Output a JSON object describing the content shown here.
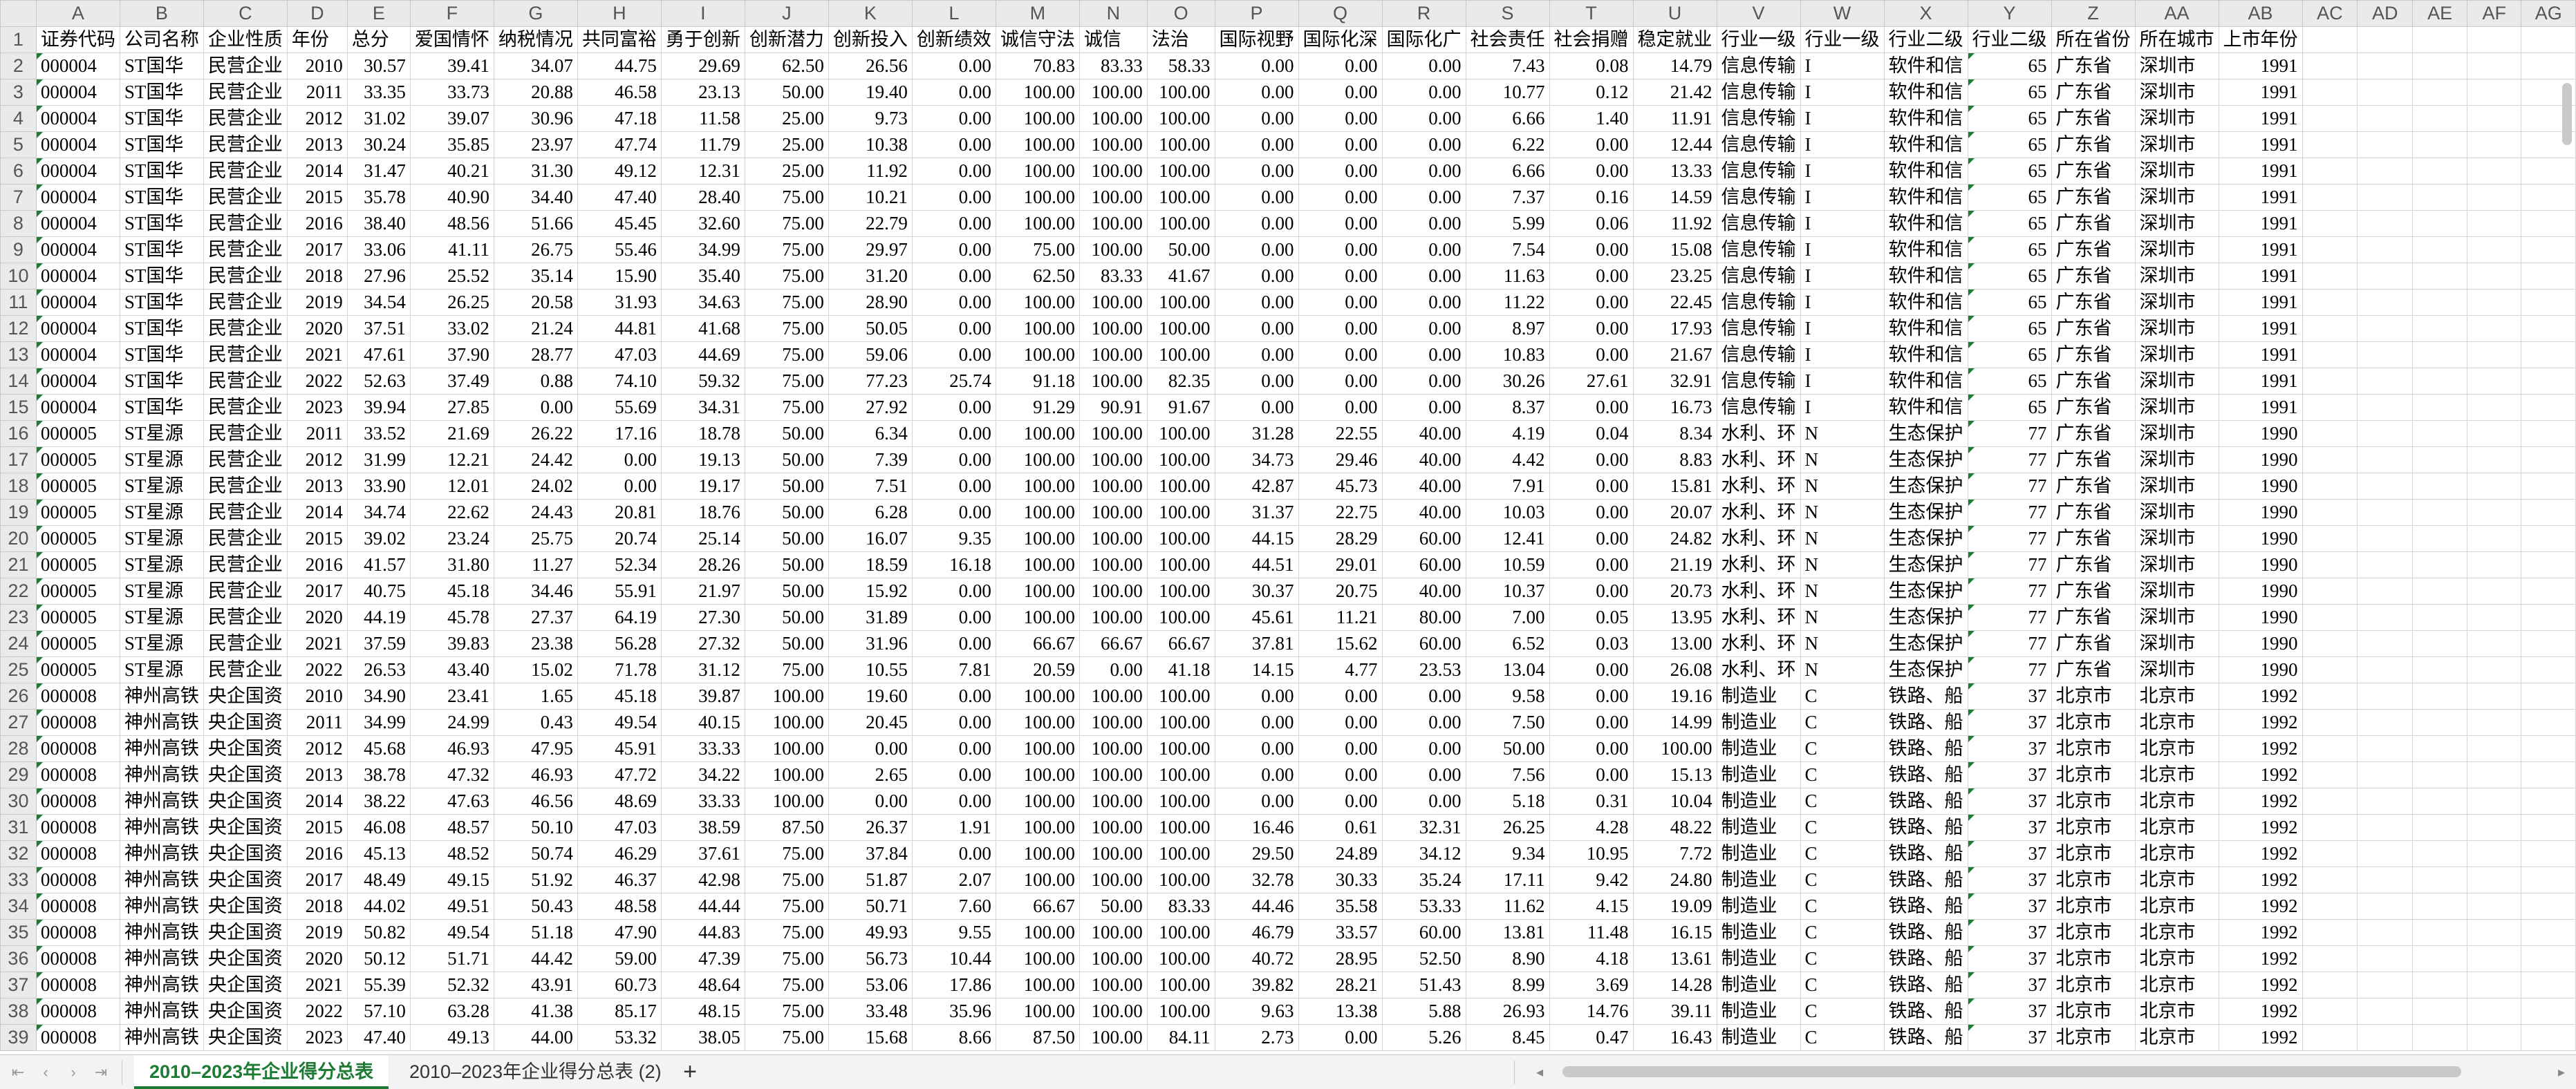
{
  "columns": [
    "A",
    "B",
    "C",
    "D",
    "E",
    "F",
    "G",
    "H",
    "I",
    "J",
    "K",
    "L",
    "M",
    "N",
    "O",
    "P",
    "Q",
    "R",
    "S",
    "T",
    "U",
    "V",
    "W",
    "X",
    "Y",
    "Z",
    "AA",
    "AB",
    "AC",
    "AD",
    "AE",
    "AF",
    "AG"
  ],
  "header_row": [
    "证券代码",
    "公司名称",
    "企业性质",
    "年份",
    "总分",
    "爱国情怀",
    "纳税情况",
    "共同富裕",
    "勇于创新",
    "创新潜力",
    "创新投入",
    "创新绩效",
    "诚信守法",
    "诚信",
    "法治",
    "国际视野",
    "国际化深",
    "国际化广",
    "社会责任",
    "社会捐赠",
    "稳定就业",
    "行业一级",
    "行业一级",
    "行业二级",
    "行业二级",
    "所在省份",
    "所在城市",
    "上市年份",
    "",
    "",
    "",
    "",
    ""
  ],
  "rows": [
    [
      "000004",
      "ST国华",
      "民营企业",
      "2010",
      "30.57",
      "39.41",
      "34.07",
      "44.75",
      "29.69",
      "62.50",
      "26.56",
      "0.00",
      "70.83",
      "83.33",
      "58.33",
      "0.00",
      "0.00",
      "0.00",
      "7.43",
      "0.08",
      "14.79",
      "信息传输",
      "I",
      "软件和信",
      "65",
      "广东省",
      "深圳市",
      "1991"
    ],
    [
      "000004",
      "ST国华",
      "民营企业",
      "2011",
      "33.35",
      "33.73",
      "20.88",
      "46.58",
      "23.13",
      "50.00",
      "19.40",
      "0.00",
      "100.00",
      "100.00",
      "100.00",
      "0.00",
      "0.00",
      "0.00",
      "10.77",
      "0.12",
      "21.42",
      "信息传输",
      "I",
      "软件和信",
      "65",
      "广东省",
      "深圳市",
      "1991"
    ],
    [
      "000004",
      "ST国华",
      "民营企业",
      "2012",
      "31.02",
      "39.07",
      "30.96",
      "47.18",
      "11.58",
      "25.00",
      "9.73",
      "0.00",
      "100.00",
      "100.00",
      "100.00",
      "0.00",
      "0.00",
      "0.00",
      "6.66",
      "1.40",
      "11.91",
      "信息传输",
      "I",
      "软件和信",
      "65",
      "广东省",
      "深圳市",
      "1991"
    ],
    [
      "000004",
      "ST国华",
      "民营企业",
      "2013",
      "30.24",
      "35.85",
      "23.97",
      "47.74",
      "11.79",
      "25.00",
      "10.38",
      "0.00",
      "100.00",
      "100.00",
      "100.00",
      "0.00",
      "0.00",
      "0.00",
      "6.22",
      "0.00",
      "12.44",
      "信息传输",
      "I",
      "软件和信",
      "65",
      "广东省",
      "深圳市",
      "1991"
    ],
    [
      "000004",
      "ST国华",
      "民营企业",
      "2014",
      "31.47",
      "40.21",
      "31.30",
      "49.12",
      "12.31",
      "25.00",
      "11.92",
      "0.00",
      "100.00",
      "100.00",
      "100.00",
      "0.00",
      "0.00",
      "0.00",
      "6.66",
      "0.00",
      "13.33",
      "信息传输",
      "I",
      "软件和信",
      "65",
      "广东省",
      "深圳市",
      "1991"
    ],
    [
      "000004",
      "ST国华",
      "民营企业",
      "2015",
      "35.78",
      "40.90",
      "34.40",
      "47.40",
      "28.40",
      "75.00",
      "10.21",
      "0.00",
      "100.00",
      "100.00",
      "100.00",
      "0.00",
      "0.00",
      "0.00",
      "7.37",
      "0.16",
      "14.59",
      "信息传输",
      "I",
      "软件和信",
      "65",
      "广东省",
      "深圳市",
      "1991"
    ],
    [
      "000004",
      "ST国华",
      "民营企业",
      "2016",
      "38.40",
      "48.56",
      "51.66",
      "45.45",
      "32.60",
      "75.00",
      "22.79",
      "0.00",
      "100.00",
      "100.00",
      "100.00",
      "0.00",
      "0.00",
      "0.00",
      "5.99",
      "0.06",
      "11.92",
      "信息传输",
      "I",
      "软件和信",
      "65",
      "广东省",
      "深圳市",
      "1991"
    ],
    [
      "000004",
      "ST国华",
      "民营企业",
      "2017",
      "33.06",
      "41.11",
      "26.75",
      "55.46",
      "34.99",
      "75.00",
      "29.97",
      "0.00",
      "75.00",
      "100.00",
      "50.00",
      "0.00",
      "0.00",
      "0.00",
      "7.54",
      "0.00",
      "15.08",
      "信息传输",
      "I",
      "软件和信",
      "65",
      "广东省",
      "深圳市",
      "1991"
    ],
    [
      "000004",
      "ST国华",
      "民营企业",
      "2018",
      "27.96",
      "25.52",
      "35.14",
      "15.90",
      "35.40",
      "75.00",
      "31.20",
      "0.00",
      "62.50",
      "83.33",
      "41.67",
      "0.00",
      "0.00",
      "0.00",
      "11.63",
      "0.00",
      "23.25",
      "信息传输",
      "I",
      "软件和信",
      "65",
      "广东省",
      "深圳市",
      "1991"
    ],
    [
      "000004",
      "ST国华",
      "民营企业",
      "2019",
      "34.54",
      "26.25",
      "20.58",
      "31.93",
      "34.63",
      "75.00",
      "28.90",
      "0.00",
      "100.00",
      "100.00",
      "100.00",
      "0.00",
      "0.00",
      "0.00",
      "11.22",
      "0.00",
      "22.45",
      "信息传输",
      "I",
      "软件和信",
      "65",
      "广东省",
      "深圳市",
      "1991"
    ],
    [
      "000004",
      "ST国华",
      "民营企业",
      "2020",
      "37.51",
      "33.02",
      "21.24",
      "44.81",
      "41.68",
      "75.00",
      "50.05",
      "0.00",
      "100.00",
      "100.00",
      "100.00",
      "0.00",
      "0.00",
      "0.00",
      "8.97",
      "0.00",
      "17.93",
      "信息传输",
      "I",
      "软件和信",
      "65",
      "广东省",
      "深圳市",
      "1991"
    ],
    [
      "000004",
      "ST国华",
      "民营企业",
      "2021",
      "47.61",
      "37.90",
      "28.77",
      "47.03",
      "44.69",
      "75.00",
      "59.06",
      "0.00",
      "100.00",
      "100.00",
      "100.00",
      "0.00",
      "0.00",
      "0.00",
      "10.83",
      "0.00",
      "21.67",
      "信息传输",
      "I",
      "软件和信",
      "65",
      "广东省",
      "深圳市",
      "1991"
    ],
    [
      "000004",
      "ST国华",
      "民营企业",
      "2022",
      "52.63",
      "37.49",
      "0.88",
      "74.10",
      "59.32",
      "75.00",
      "77.23",
      "25.74",
      "91.18",
      "100.00",
      "82.35",
      "0.00",
      "0.00",
      "0.00",
      "30.26",
      "27.61",
      "32.91",
      "信息传输",
      "I",
      "软件和信",
      "65",
      "广东省",
      "深圳市",
      "1991"
    ],
    [
      "000004",
      "ST国华",
      "民营企业",
      "2023",
      "39.94",
      "27.85",
      "0.00",
      "55.69",
      "34.31",
      "75.00",
      "27.92",
      "0.00",
      "91.29",
      "90.91",
      "91.67",
      "0.00",
      "0.00",
      "0.00",
      "8.37",
      "0.00",
      "16.73",
      "信息传输",
      "I",
      "软件和信",
      "65",
      "广东省",
      "深圳市",
      "1991"
    ],
    [
      "000005",
      "ST星源",
      "民营企业",
      "2011",
      "33.52",
      "21.69",
      "26.22",
      "17.16",
      "18.78",
      "50.00",
      "6.34",
      "0.00",
      "100.00",
      "100.00",
      "100.00",
      "31.28",
      "22.55",
      "40.00",
      "4.19",
      "0.04",
      "8.34",
      "水利、环",
      "N",
      "生态保护",
      "77",
      "广东省",
      "深圳市",
      "1990"
    ],
    [
      "000005",
      "ST星源",
      "民营企业",
      "2012",
      "31.99",
      "12.21",
      "24.42",
      "0.00",
      "19.13",
      "50.00",
      "7.39",
      "0.00",
      "100.00",
      "100.00",
      "100.00",
      "34.73",
      "29.46",
      "40.00",
      "4.42",
      "0.00",
      "8.83",
      "水利、环",
      "N",
      "生态保护",
      "77",
      "广东省",
      "深圳市",
      "1990"
    ],
    [
      "000005",
      "ST星源",
      "民营企业",
      "2013",
      "33.90",
      "12.01",
      "24.02",
      "0.00",
      "19.17",
      "50.00",
      "7.51",
      "0.00",
      "100.00",
      "100.00",
      "100.00",
      "42.87",
      "45.73",
      "40.00",
      "7.91",
      "0.00",
      "15.81",
      "水利、环",
      "N",
      "生态保护",
      "77",
      "广东省",
      "深圳市",
      "1990"
    ],
    [
      "000005",
      "ST星源",
      "民营企业",
      "2014",
      "34.74",
      "22.62",
      "24.43",
      "20.81",
      "18.76",
      "50.00",
      "6.28",
      "0.00",
      "100.00",
      "100.00",
      "100.00",
      "31.37",
      "22.75",
      "40.00",
      "10.03",
      "0.00",
      "20.07",
      "水利、环",
      "N",
      "生态保护",
      "77",
      "广东省",
      "深圳市",
      "1990"
    ],
    [
      "000005",
      "ST星源",
      "民营企业",
      "2015",
      "39.02",
      "23.24",
      "25.75",
      "20.74",
      "25.14",
      "50.00",
      "16.07",
      "9.35",
      "100.00",
      "100.00",
      "100.00",
      "44.15",
      "28.29",
      "60.00",
      "12.41",
      "0.00",
      "24.82",
      "水利、环",
      "N",
      "生态保护",
      "77",
      "广东省",
      "深圳市",
      "1990"
    ],
    [
      "000005",
      "ST星源",
      "民营企业",
      "2016",
      "41.57",
      "31.80",
      "11.27",
      "52.34",
      "28.26",
      "50.00",
      "18.59",
      "16.18",
      "100.00",
      "100.00",
      "100.00",
      "44.51",
      "29.01",
      "60.00",
      "10.59",
      "0.00",
      "21.19",
      "水利、环",
      "N",
      "生态保护",
      "77",
      "广东省",
      "深圳市",
      "1990"
    ],
    [
      "000005",
      "ST星源",
      "民营企业",
      "2017",
      "40.75",
      "45.18",
      "34.46",
      "55.91",
      "21.97",
      "50.00",
      "15.92",
      "0.00",
      "100.00",
      "100.00",
      "100.00",
      "30.37",
      "20.75",
      "40.00",
      "10.37",
      "0.00",
      "20.73",
      "水利、环",
      "N",
      "生态保护",
      "77",
      "广东省",
      "深圳市",
      "1990"
    ],
    [
      "000005",
      "ST星源",
      "民营企业",
      "2020",
      "44.19",
      "45.78",
      "27.37",
      "64.19",
      "27.30",
      "50.00",
      "31.89",
      "0.00",
      "100.00",
      "100.00",
      "100.00",
      "45.61",
      "11.21",
      "80.00",
      "7.00",
      "0.05",
      "13.95",
      "水利、环",
      "N",
      "生态保护",
      "77",
      "广东省",
      "深圳市",
      "1990"
    ],
    [
      "000005",
      "ST星源",
      "民营企业",
      "2021",
      "37.59",
      "39.83",
      "23.38",
      "56.28",
      "27.32",
      "50.00",
      "31.96",
      "0.00",
      "66.67",
      "66.67",
      "66.67",
      "37.81",
      "15.62",
      "60.00",
      "6.52",
      "0.03",
      "13.00",
      "水利、环",
      "N",
      "生态保护",
      "77",
      "广东省",
      "深圳市",
      "1990"
    ],
    [
      "000005",
      "ST星源",
      "民营企业",
      "2022",
      "26.53",
      "43.40",
      "15.02",
      "71.78",
      "31.12",
      "75.00",
      "10.55",
      "7.81",
      "20.59",
      "0.00",
      "41.18",
      "14.15",
      "4.77",
      "23.53",
      "13.04",
      "0.00",
      "26.08",
      "水利、环",
      "N",
      "生态保护",
      "77",
      "广东省",
      "深圳市",
      "1990"
    ],
    [
      "000008",
      "神州高铁",
      "央企国资",
      "2010",
      "34.90",
      "23.41",
      "1.65",
      "45.18",
      "39.87",
      "100.00",
      "19.60",
      "0.00",
      "100.00",
      "100.00",
      "100.00",
      "0.00",
      "0.00",
      "0.00",
      "9.58",
      "0.00",
      "19.16",
      "制造业",
      "C",
      "铁路、船",
      "37",
      "北京市",
      "北京市",
      "1992"
    ],
    [
      "000008",
      "神州高铁",
      "央企国资",
      "2011",
      "34.99",
      "24.99",
      "0.43",
      "49.54",
      "40.15",
      "100.00",
      "20.45",
      "0.00",
      "100.00",
      "100.00",
      "100.00",
      "0.00",
      "0.00",
      "0.00",
      "7.50",
      "0.00",
      "14.99",
      "制造业",
      "C",
      "铁路、船",
      "37",
      "北京市",
      "北京市",
      "1992"
    ],
    [
      "000008",
      "神州高铁",
      "央企国资",
      "2012",
      "45.68",
      "46.93",
      "47.95",
      "45.91",
      "33.33",
      "100.00",
      "0.00",
      "0.00",
      "100.00",
      "100.00",
      "100.00",
      "0.00",
      "0.00",
      "0.00",
      "50.00",
      "0.00",
      "100.00",
      "制造业",
      "C",
      "铁路、船",
      "37",
      "北京市",
      "北京市",
      "1992"
    ],
    [
      "000008",
      "神州高铁",
      "央企国资",
      "2013",
      "38.78",
      "47.32",
      "46.93",
      "47.72",
      "34.22",
      "100.00",
      "2.65",
      "0.00",
      "100.00",
      "100.00",
      "100.00",
      "0.00",
      "0.00",
      "0.00",
      "7.56",
      "0.00",
      "15.13",
      "制造业",
      "C",
      "铁路、船",
      "37",
      "北京市",
      "北京市",
      "1992"
    ],
    [
      "000008",
      "神州高铁",
      "央企国资",
      "2014",
      "38.22",
      "47.63",
      "46.56",
      "48.69",
      "33.33",
      "100.00",
      "0.00",
      "0.00",
      "100.00",
      "100.00",
      "100.00",
      "0.00",
      "0.00",
      "0.00",
      "5.18",
      "0.31",
      "10.04",
      "制造业",
      "C",
      "铁路、船",
      "37",
      "北京市",
      "北京市",
      "1992"
    ],
    [
      "000008",
      "神州高铁",
      "央企国资",
      "2015",
      "46.08",
      "48.57",
      "50.10",
      "47.03",
      "38.59",
      "87.50",
      "26.37",
      "1.91",
      "100.00",
      "100.00",
      "100.00",
      "16.46",
      "0.61",
      "32.31",
      "26.25",
      "4.28",
      "48.22",
      "制造业",
      "C",
      "铁路、船",
      "37",
      "北京市",
      "北京市",
      "1992"
    ],
    [
      "000008",
      "神州高铁",
      "央企国资",
      "2016",
      "45.13",
      "48.52",
      "50.74",
      "46.29",
      "37.61",
      "75.00",
      "37.84",
      "0.00",
      "100.00",
      "100.00",
      "100.00",
      "29.50",
      "24.89",
      "34.12",
      "9.34",
      "10.95",
      "7.72",
      "制造业",
      "C",
      "铁路、船",
      "37",
      "北京市",
      "北京市",
      "1992"
    ],
    [
      "000008",
      "神州高铁",
      "央企国资",
      "2017",
      "48.49",
      "49.15",
      "51.92",
      "46.37",
      "42.98",
      "75.00",
      "51.87",
      "2.07",
      "100.00",
      "100.00",
      "100.00",
      "32.78",
      "30.33",
      "35.24",
      "17.11",
      "9.42",
      "24.80",
      "制造业",
      "C",
      "铁路、船",
      "37",
      "北京市",
      "北京市",
      "1992"
    ],
    [
      "000008",
      "神州高铁",
      "央企国资",
      "2018",
      "44.02",
      "49.51",
      "50.43",
      "48.58",
      "44.44",
      "75.00",
      "50.71",
      "7.60",
      "66.67",
      "50.00",
      "83.33",
      "44.46",
      "35.58",
      "53.33",
      "11.62",
      "4.15",
      "19.09",
      "制造业",
      "C",
      "铁路、船",
      "37",
      "北京市",
      "北京市",
      "1992"
    ],
    [
      "000008",
      "神州高铁",
      "央企国资",
      "2019",
      "50.82",
      "49.54",
      "51.18",
      "47.90",
      "44.83",
      "75.00",
      "49.93",
      "9.55",
      "100.00",
      "100.00",
      "100.00",
      "46.79",
      "33.57",
      "60.00",
      "13.81",
      "11.48",
      "16.15",
      "制造业",
      "C",
      "铁路、船",
      "37",
      "北京市",
      "北京市",
      "1992"
    ],
    [
      "000008",
      "神州高铁",
      "央企国资",
      "2020",
      "50.12",
      "51.71",
      "44.42",
      "59.00",
      "47.39",
      "75.00",
      "56.73",
      "10.44",
      "100.00",
      "100.00",
      "100.00",
      "40.72",
      "28.95",
      "52.50",
      "8.90",
      "4.18",
      "13.61",
      "制造业",
      "C",
      "铁路、船",
      "37",
      "北京市",
      "北京市",
      "1992"
    ],
    [
      "000008",
      "神州高铁",
      "央企国资",
      "2021",
      "55.39",
      "52.32",
      "43.91",
      "60.73",
      "48.64",
      "75.00",
      "53.06",
      "17.86",
      "100.00",
      "100.00",
      "100.00",
      "39.82",
      "28.21",
      "51.43",
      "8.99",
      "3.69",
      "14.28",
      "制造业",
      "C",
      "铁路、船",
      "37",
      "北京市",
      "北京市",
      "1992"
    ],
    [
      "000008",
      "神州高铁",
      "央企国资",
      "2022",
      "57.10",
      "63.28",
      "41.38",
      "85.17",
      "48.15",
      "75.00",
      "33.48",
      "35.96",
      "100.00",
      "100.00",
      "100.00",
      "9.63",
      "13.38",
      "5.88",
      "26.93",
      "14.76",
      "39.11",
      "制造业",
      "C",
      "铁路、船",
      "37",
      "北京市",
      "北京市",
      "1992"
    ],
    [
      "000008",
      "神州高铁",
      "央企国资",
      "2023",
      "47.40",
      "49.13",
      "44.00",
      "53.32",
      "38.05",
      "75.00",
      "15.68",
      "8.66",
      "87.50",
      "100.00",
      "84.11",
      "2.73",
      "0.00",
      "5.26",
      "8.45",
      "0.47",
      "16.43",
      "制造业",
      "C",
      "铁路、船",
      "37",
      "北京市",
      "北京市",
      "1992"
    ]
  ],
  "sheets": [
    {
      "label": "2010–2023年企业得分总表",
      "active": true
    },
    {
      "label": "2010–2023年企业得分总表 (2)",
      "active": false
    }
  ],
  "add_sheet_label": "+",
  "nav": {
    "first": "⇤",
    "prev": "‹",
    "next": "›",
    "last": "⇥"
  },
  "colors": {
    "accent": "#1e7b34",
    "header_bg": "#eaeaea",
    "grid": "#d4d4d4"
  }
}
